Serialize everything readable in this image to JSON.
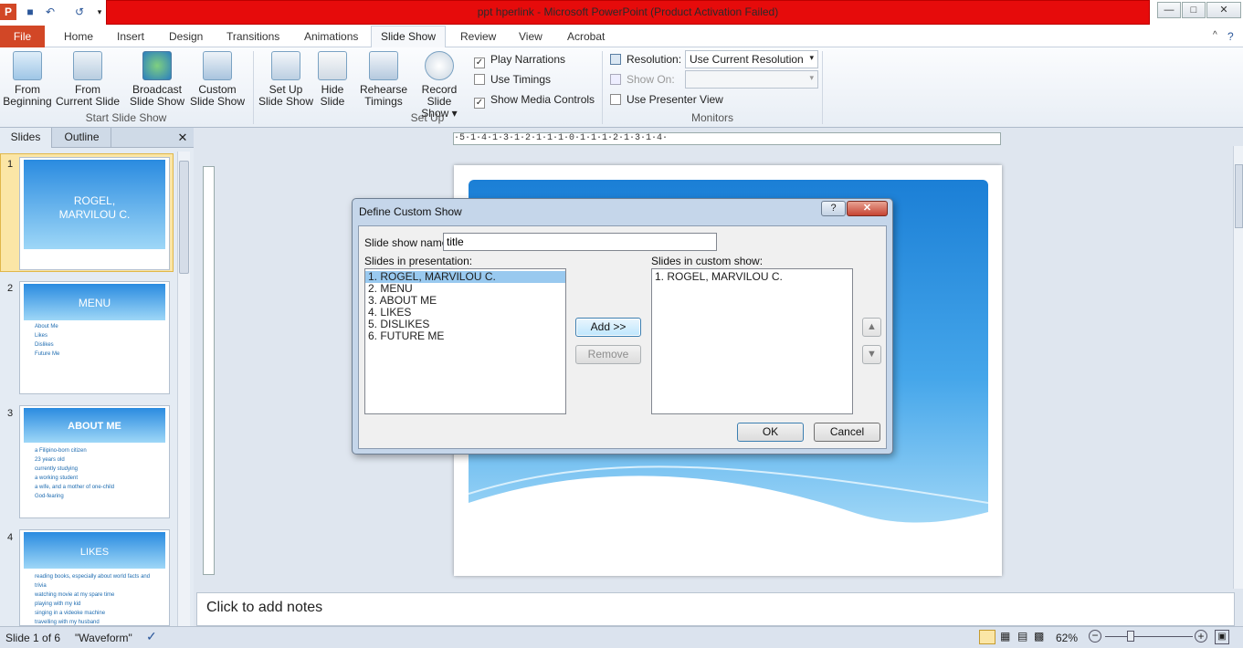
{
  "window": {
    "title": "ppt hperlink  -  Microsoft PowerPoint (Product Activation Failed)"
  },
  "ribbon_tabs": [
    "File",
    "Home",
    "Insert",
    "Design",
    "Transitions",
    "Animations",
    "Slide Show",
    "Review",
    "View",
    "Acrobat"
  ],
  "ribbon": {
    "from_beginning": [
      "From",
      "Beginning"
    ],
    "from_current": [
      "From",
      "Current Slide"
    ],
    "broadcast": [
      "Broadcast",
      "Slide Show"
    ],
    "custom": [
      "Custom",
      "Slide Show"
    ],
    "group_start": "Start Slide Show",
    "setup": [
      "Set Up",
      "Slide Show"
    ],
    "hide": [
      "Hide",
      "Slide"
    ],
    "rehearse": [
      "Rehearse",
      "Timings"
    ],
    "record": [
      "Record Slide",
      "Show"
    ],
    "play_narrations": "Play Narrations",
    "use_timings": "Use Timings",
    "show_media": "Show Media Controls",
    "group_setup": "Set Up",
    "resolution_label": "Resolution:",
    "resolution_value": "Use Current Resolution",
    "show_on_label": "Show On:",
    "presenter_view": "Use Presenter View",
    "group_monitors": "Monitors"
  },
  "panel": {
    "tab_slides": "Slides",
    "tab_outline": "Outline",
    "thumbs": [
      {
        "num": "1",
        "title": "ROGEL,\nMARVILOU C.",
        "bullets": []
      },
      {
        "num": "2",
        "title": "MENU",
        "bullets": [
          "About Me",
          "Likes",
          "Dislikes",
          "Future Me"
        ]
      },
      {
        "num": "3",
        "title": "ABOUT ME",
        "bullets": [
          "a Filipino-born citizen",
          "23 years old",
          "currently studying",
          "a working student",
          "a wife, and a mother of one-child",
          "God-fearing"
        ]
      },
      {
        "num": "4",
        "title": "LIKES",
        "bullets": [
          "reading books, especially about world facts and trivia",
          "watching movie at my spare time",
          "playing with my kid",
          "singing in a videoke machine",
          "travelling with my husband"
        ]
      }
    ]
  },
  "ruler_text": "·5·1·4·1·3·1·2·1·1·1·0·1·1·1·2·1·3·1·4·",
  "notes_placeholder": "Click to add notes",
  "status": {
    "slide": "Slide 1 of 6",
    "theme": "\"Waveform\"",
    "zoom": "62%"
  },
  "dialog": {
    "title": "Define Custom Show",
    "name_label": "Slide show name:",
    "name_value": "title",
    "left_label": "Slides in presentation:",
    "right_label": "Slides in custom show:",
    "presentation_slides": [
      "1. ROGEL, MARVILOU C.",
      "2. MENU",
      "3. ABOUT ME",
      "4. LIKES",
      "5. DISLIKES",
      "6. FUTURE ME"
    ],
    "custom_slides": [
      "1. ROGEL, MARVILOU C."
    ],
    "add_button": "Add >>",
    "remove_button": "Remove",
    "ok_button": "OK",
    "cancel_button": "Cancel"
  },
  "colors": {
    "accent": "#d24726",
    "titlebar": "#e60b0b",
    "selection": "#99c9ef"
  }
}
